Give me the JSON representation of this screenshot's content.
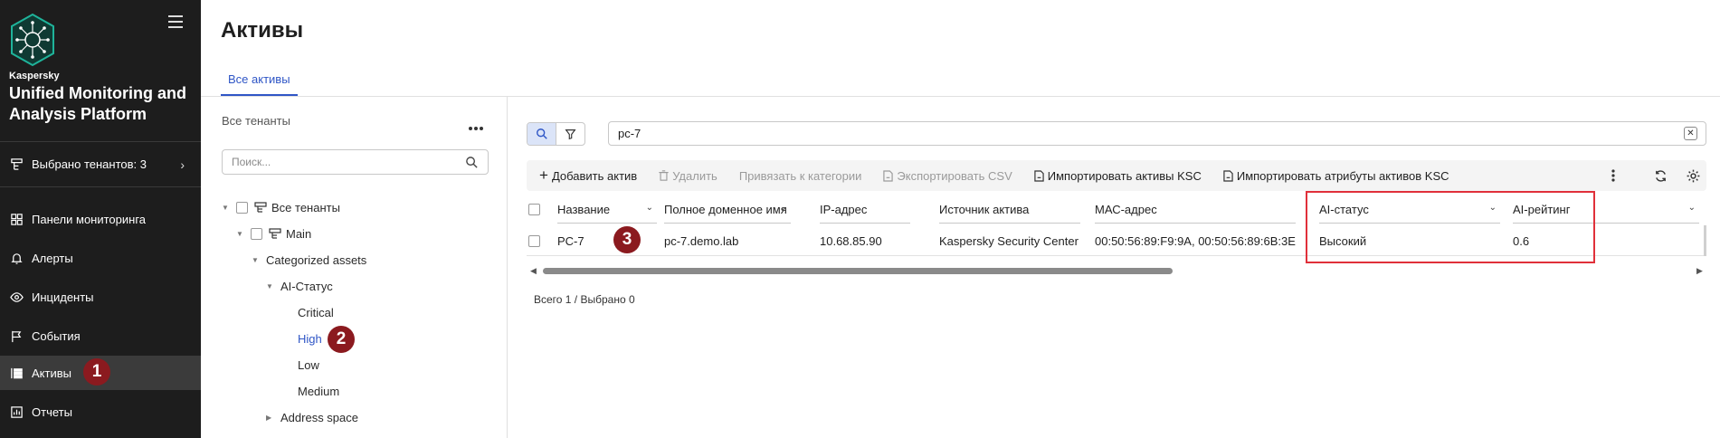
{
  "sidebar": {
    "brand_small": "Kaspersky",
    "brand_title": "Unified Monitoring and Analysis Platform",
    "tenant_select": "Выбрано тенантов: 3",
    "nav": [
      {
        "label": "Панели мониторинга",
        "icon": "dashboard-icon"
      },
      {
        "label": "Алерты",
        "icon": "bell-icon"
      },
      {
        "label": "Инциденты",
        "icon": "eye-icon"
      },
      {
        "label": "События",
        "icon": "flag-icon"
      },
      {
        "label": "Активы",
        "icon": "assets-icon",
        "active": true
      },
      {
        "label": "Отчеты",
        "icon": "report-icon"
      }
    ]
  },
  "badges": [
    "1",
    "2",
    "3"
  ],
  "header": {
    "title": "Активы",
    "tab": "Все активы"
  },
  "tree": {
    "heading": "Все тенанты",
    "search_placeholder": "Поиск...",
    "nodes": {
      "all": "Все тенанты",
      "main": "Main",
      "categorized": "Categorized assets",
      "ai_status": "AI-Статус",
      "critical": "Critical",
      "high": "High",
      "low": "Low",
      "medium": "Medium",
      "address_space": "Address space"
    }
  },
  "search": {
    "value": "pc-7",
    "clear": "✕"
  },
  "toolbar": {
    "add": "Добавить актив",
    "delete": "Удалить",
    "link_category": "Привязать к категории",
    "export_csv": "Экспортировать CSV",
    "import_ksc": "Импортировать активы KSC",
    "import_attrs": "Импортировать атрибуты активов KSC"
  },
  "table": {
    "columns": {
      "name": "Название",
      "fqdn": "Полное доменное имя",
      "ip": "IP-адрес",
      "source": "Источник актива",
      "mac": "МАС-адрес",
      "ai_status": "AI-статус",
      "ai_rating": "AI-рейтинг"
    },
    "row": {
      "name": "PC-7",
      "fqdn": "pc-7.demo.lab",
      "ip": "10.68.85.90",
      "source": "Kaspersky Security Center",
      "mac": "00:50:56:89:F9:9A, 00:50:56:89:6B:3E",
      "ai_status": "Высокий",
      "ai_rating": "0.6"
    }
  },
  "totals": "Всего 1 / Выбрано 0",
  "colors": {
    "sidebar_bg": "#1d1d1d",
    "accent": "#2f56c6",
    "badge": "#8b1a1f",
    "highlight": "#e0303a"
  }
}
